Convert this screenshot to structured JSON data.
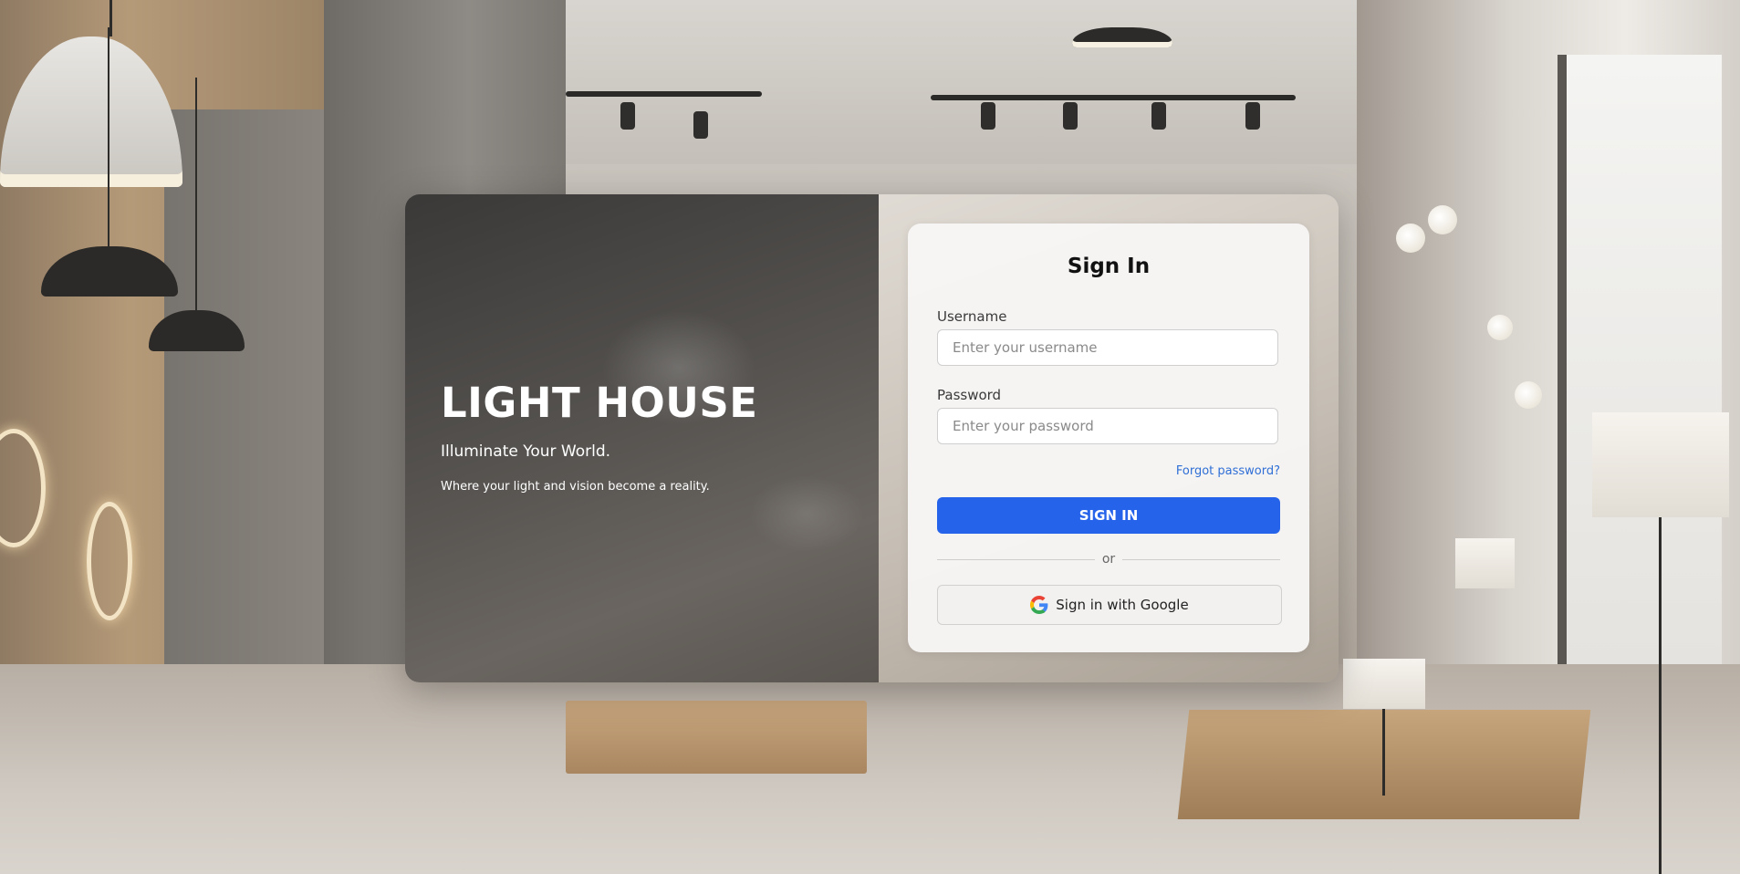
{
  "brand": {
    "title": "LIGHT HOUSE",
    "tagline": "Illuminate Your World.",
    "subtitle": "Where your light and vision become a reality."
  },
  "login": {
    "heading": "Sign In",
    "username_label": "Username",
    "username_placeholder": "Enter your username",
    "username_value": "",
    "password_label": "Password",
    "password_placeholder": "Enter your password",
    "password_value": "",
    "forgot_link": "Forgot password?",
    "signin_button": "SIGN IN",
    "divider_text": "or",
    "google_button": "Sign in with Google",
    "google_icon": "google-g-icon"
  },
  "colors": {
    "primary_button": "#2563eb",
    "link": "#2f6fd6"
  }
}
